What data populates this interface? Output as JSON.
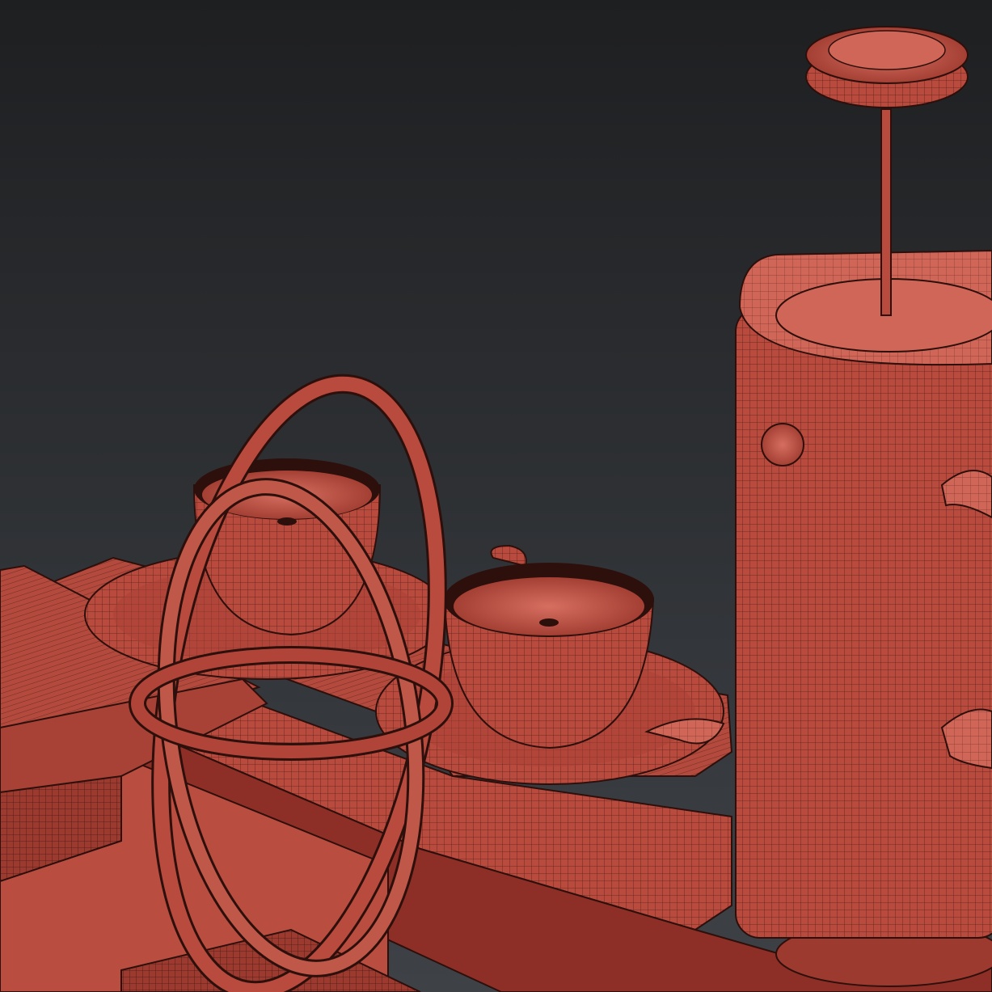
{
  "scene": {
    "description_hidden": "",
    "colors": {
      "background_top": "#1e1f21",
      "background_bottom": "#3c4045",
      "mesh_fill": "#b84a3e",
      "mesh_fill_light": "#cf6658",
      "mesh_fill_dark": "#8e2f27",
      "wire": "#3a1410",
      "floor_shadow": "#52231d"
    },
    "objects": [
      {
        "name": "french-press",
        "kind": "mesh"
      },
      {
        "name": "coffee-cup-front",
        "kind": "mesh"
      },
      {
        "name": "coffee-cup-back",
        "kind": "mesh"
      },
      {
        "name": "saucer-front",
        "kind": "mesh"
      },
      {
        "name": "saucer-back",
        "kind": "mesh"
      },
      {
        "name": "wooden-tray",
        "kind": "mesh"
      },
      {
        "name": "ring-sculpture",
        "kind": "mesh"
      },
      {
        "name": "open-book",
        "kind": "mesh"
      },
      {
        "name": "small-tray",
        "kind": "mesh"
      },
      {
        "name": "spoon",
        "kind": "mesh"
      }
    ]
  }
}
